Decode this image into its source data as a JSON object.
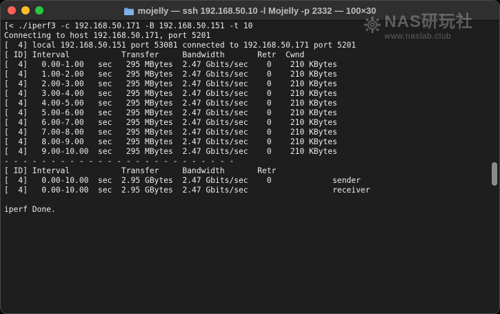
{
  "window": {
    "title": "mojelly — ssh 192.168.50.10 -l Mojelly -p 2332 — 100×30"
  },
  "watermark": {
    "line1": "NAS研玩社",
    "line2": "www.naslab.club"
  },
  "terminal": {
    "lines": [
      "[< ./iperf3 -c 192.168.50.171 -B 192.168.50.151 -t 10",
      "Connecting to host 192.168.50.171, port 5201",
      "[  4] local 192.168.50.151 port 53081 connected to 192.168.50.171 port 5201",
      "[ ID] Interval           Transfer     Bandwidth       Retr  Cwnd",
      "[  4]   0.00-1.00   sec   295 MBytes  2.47 Gbits/sec    0    210 KBytes",
      "[  4]   1.00-2.00   sec   295 MBytes  2.47 Gbits/sec    0    210 KBytes",
      "[  4]   2.00-3.00   sec   295 MBytes  2.47 Gbits/sec    0    210 KBytes",
      "[  4]   3.00-4.00   sec   295 MBytes  2.47 Gbits/sec    0    210 KBytes",
      "[  4]   4.00-5.00   sec   295 MBytes  2.47 Gbits/sec    0    210 KBytes",
      "[  4]   5.00-6.00   sec   295 MBytes  2.47 Gbits/sec    0    210 KBytes",
      "[  4]   6.00-7.00   sec   295 MBytes  2.47 Gbits/sec    0    210 KBytes",
      "[  4]   7.00-8.00   sec   295 MBytes  2.47 Gbits/sec    0    210 KBytes",
      "[  4]   8.00-9.00   sec   295 MBytes  2.47 Gbits/sec    0    210 KBytes",
      "[  4]   9.00-10.00  sec   295 MBytes  2.47 Gbits/sec    0    210 KBytes",
      "- - - - - - - - - - - - - - - - - - - - - - - - -",
      "[ ID] Interval           Transfer     Bandwidth       Retr",
      "[  4]   0.00-10.00  sec  2.95 GBytes  2.47 Gbits/sec    0             sender",
      "[  4]   0.00-10.00  sec  2.95 GBytes  2.47 Gbits/sec                  receiver",
      "",
      "iperf Done."
    ]
  },
  "icons": {
    "close": "close-traffic-light",
    "minimize": "minimize-traffic-light",
    "maximize": "maximize-traffic-light",
    "folder": "folder-icon",
    "watermark_logo": "gear-icon"
  },
  "colors": {
    "background": "#1e1e1e",
    "titlebar": "#2f2f2f",
    "text": "#ececec",
    "close": "#fe5f57",
    "minimize": "#febc2e",
    "maximize": "#28c840"
  }
}
